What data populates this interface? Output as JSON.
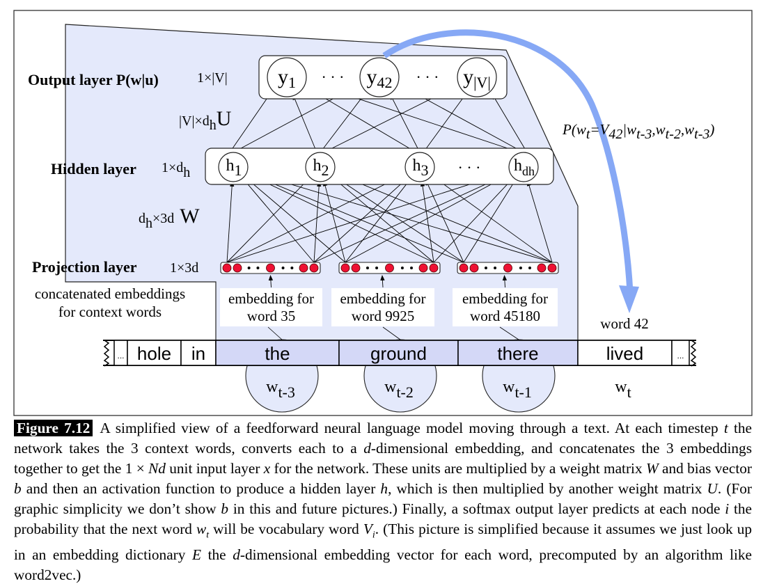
{
  "figure": {
    "tag": "Figure 7.12",
    "caption_parts": [
      {
        "t": "A simplified view of a feedforward neural language model moving through a text.  At each timestep "
      },
      {
        "t": "t",
        "i": true
      },
      {
        "t": " the network takes the 3 context words, converts each to a "
      },
      {
        "t": "d",
        "i": true
      },
      {
        "t": "-dimensional embedding, and concatenates the 3 embeddings together to get the 1 × "
      },
      {
        "t": "Nd",
        "i": true
      },
      {
        "t": " unit input layer "
      },
      {
        "t": "x",
        "i": true
      },
      {
        "t": " for the network.  These units are multiplied by a weight matrix "
      },
      {
        "t": "W",
        "i": true
      },
      {
        "t": " and bias vector "
      },
      {
        "t": "b",
        "i": true
      },
      {
        "t": " and then an activation function to produce a hidden layer "
      },
      {
        "t": "h",
        "i": true
      },
      {
        "t": ", which is then multiplied by another weight matrix "
      },
      {
        "t": "U",
        "i": true
      },
      {
        "t": ".  (For graphic simplicity we don’t show "
      },
      {
        "t": "b",
        "i": true
      },
      {
        "t": " in this and future pictures.) Finally, a softmax output layer predicts at each node "
      },
      {
        "t": "i",
        "i": true
      },
      {
        "t": " the probability that the next word "
      },
      {
        "t": "w_t",
        "i": true
      },
      {
        "t": " will be vocabulary word "
      },
      {
        "t": "V_i",
        "i": true
      },
      {
        "t": ".  (This picture is simplified because it assumes we just look up in an embedding dictionary "
      },
      {
        "t": "E",
        "i": true
      },
      {
        "t": " the "
      },
      {
        "t": "d",
        "i": true
      },
      {
        "t": "-dimensional embedding vector for each word, precomputed by an algorithm like word2vec.)"
      }
    ]
  },
  "layers": {
    "output": {
      "label": "Output layer P(w|u)",
      "dim": "1×|V|",
      "nodes": [
        {
          "base": "y",
          "sub": "1"
        },
        {
          "base": "y",
          "sub": "42"
        },
        {
          "base": "y",
          "sub": "|V|"
        }
      ],
      "ellipsis": "· · ·"
    },
    "U_matrix": {
      "dim_pre": "|V|×d",
      "dim_sub": "h",
      "name": "U"
    },
    "hidden": {
      "label": "Hidden layer",
      "dim_pre": "1×d",
      "dim_sub": "h",
      "nodes": [
        {
          "base": "h",
          "sub": "1"
        },
        {
          "base": "h",
          "sub": "2"
        },
        {
          "base": "h",
          "sub": "3"
        },
        {
          "base": "h",
          "sub": "dh"
        }
      ],
      "ellipsis": "· · ·"
    },
    "W_matrix": {
      "dim_pre": "d",
      "dim_sub": "h",
      "dim_post": "×3d",
      "name": "W"
    },
    "projection": {
      "label": "Projection layer",
      "dim": "1×3d",
      "note_line1": "concatenated embeddings",
      "note_line2": "for context words"
    }
  },
  "embeddings": [
    {
      "line1": "embedding for",
      "line2": "word 35"
    },
    {
      "line1": "embedding for",
      "line2": "word 9925"
    },
    {
      "line1": "embedding for",
      "line2": "word 45180"
    }
  ],
  "prediction": {
    "formula_parts": [
      "P(w",
      "t",
      "=V",
      "42",
      "|w",
      "t-3",
      ",w",
      "t-2",
      ",w",
      "t-3",
      ")"
    ],
    "target_label": "word 42"
  },
  "text_strip": {
    "words": [
      "...",
      "hole",
      "in",
      "the",
      "ground",
      "there",
      "lived",
      "..."
    ],
    "context_highlight": [
      "the",
      "ground",
      "there"
    ]
  },
  "positions": [
    {
      "base": "w",
      "sub": "t-3"
    },
    {
      "base": "w",
      "sub": "t-2"
    },
    {
      "base": "w",
      "sub": "t-1"
    },
    {
      "base": "w",
      "sub": "t"
    }
  ],
  "colors": {
    "context_fill": "#e4e9fb",
    "context_word_fill": "#d4d8f7",
    "arrow_blue": "#86a8f5",
    "unit_red": "#ee1133"
  }
}
